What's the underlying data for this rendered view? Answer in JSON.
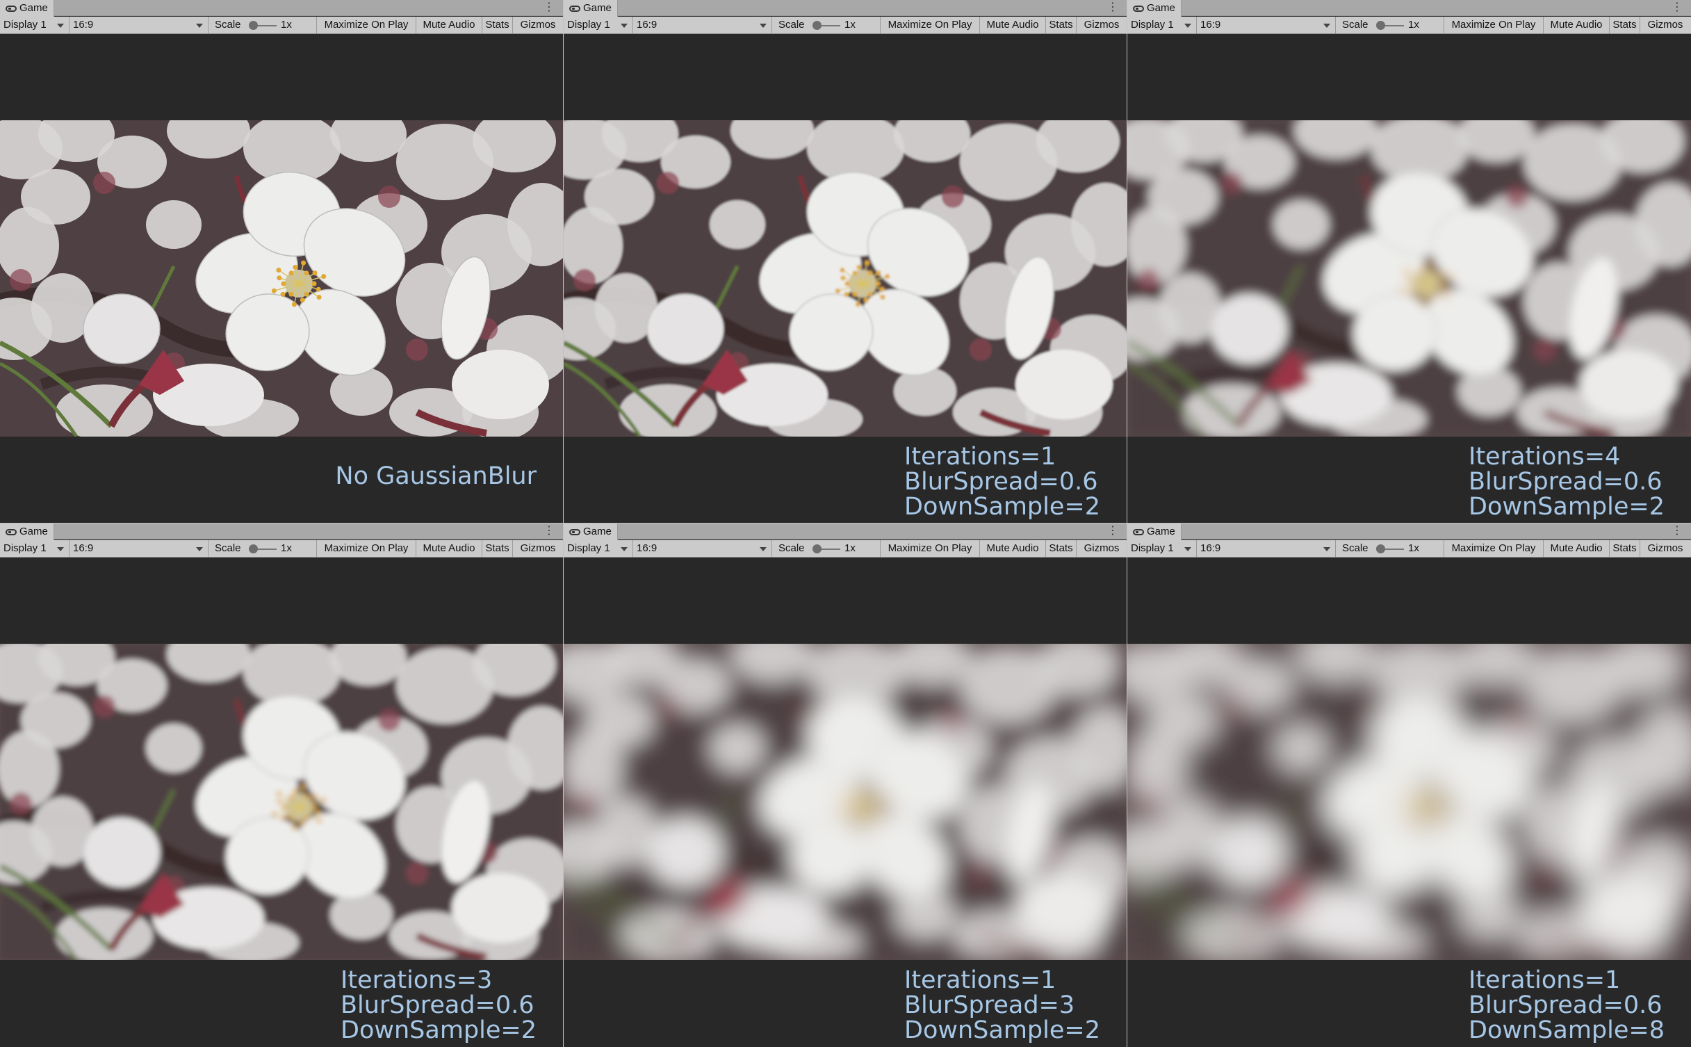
{
  "panels": [
    {
      "tab_title": "Game",
      "display": "Display 1",
      "aspect": "16:9",
      "scale_label": "Scale",
      "scale_value": "1x",
      "maximize": "Maximize On Play",
      "mute": "Mute Audio",
      "stats": "Stats",
      "gizmos": "Gizmos",
      "caption": [
        "No GaussianBlur"
      ],
      "blur_level": 0
    },
    {
      "tab_title": "Game",
      "display": "Display 1",
      "aspect": "16:9",
      "scale_label": "Scale",
      "scale_value": "1x",
      "maximize": "Maximize On Play",
      "mute": "Mute Audio",
      "stats": "Stats",
      "gizmos": "Gizmos",
      "caption": [
        "Iterations=1",
        "BlurSpread=0.6",
        "DownSample=2"
      ],
      "blur_level": 1.5
    },
    {
      "tab_title": "Game",
      "display": "Display 1",
      "aspect": "16:9",
      "scale_label": "Scale",
      "scale_value": "1x",
      "maximize": "Maximize On Play",
      "mute": "Mute Audio",
      "stats": "Stats",
      "gizmos": "Gizmos",
      "caption": [
        "Iterations=4",
        "BlurSpread=0.6",
        "DownSample=2"
      ],
      "blur_level": 7
    },
    {
      "tab_title": "Game",
      "display": "Display 1",
      "aspect": "16:9",
      "scale_label": "Scale",
      "scale_value": "1x",
      "maximize": "Maximize On Play",
      "mute": "Mute Audio",
      "stats": "Stats",
      "gizmos": "Gizmos",
      "caption": [
        "Iterations=3",
        "BlurSpread=0.6",
        "DownSample=2"
      ],
      "blur_level": 4
    },
    {
      "tab_title": "Game",
      "display": "Display 1",
      "aspect": "16:9",
      "scale_label": "Scale",
      "scale_value": "1x",
      "maximize": "Maximize On Play",
      "mute": "Mute Audio",
      "stats": "Stats",
      "gizmos": "Gizmos",
      "caption": [
        "Iterations=1",
        "BlurSpread=3",
        "DownSample=2"
      ],
      "blur_level": 16
    },
    {
      "tab_title": "Game",
      "display": "Display 1",
      "aspect": "16:9",
      "scale_label": "Scale",
      "scale_value": "1x",
      "maximize": "Maximize On Play",
      "mute": "Mute Audio",
      "stats": "Stats",
      "gizmos": "Gizmos",
      "caption": [
        "Iterations=1",
        "BlurSpread=0.6",
        "DownSample=8"
      ],
      "blur_level": 20
    }
  ],
  "colors": {
    "viewport_bg": "#282828",
    "toolbar_bg": "#cbcbcb",
    "caption": "#a7c7e6",
    "petal": "#ededeb",
    "stamen": "#e1a832",
    "stem": "#7a3038",
    "leaf": "#5f7a3a"
  },
  "icons": {
    "tab": "gamepad-icon",
    "menu": "kebab-menu-icon",
    "dropdown": "chevron-down-icon"
  }
}
